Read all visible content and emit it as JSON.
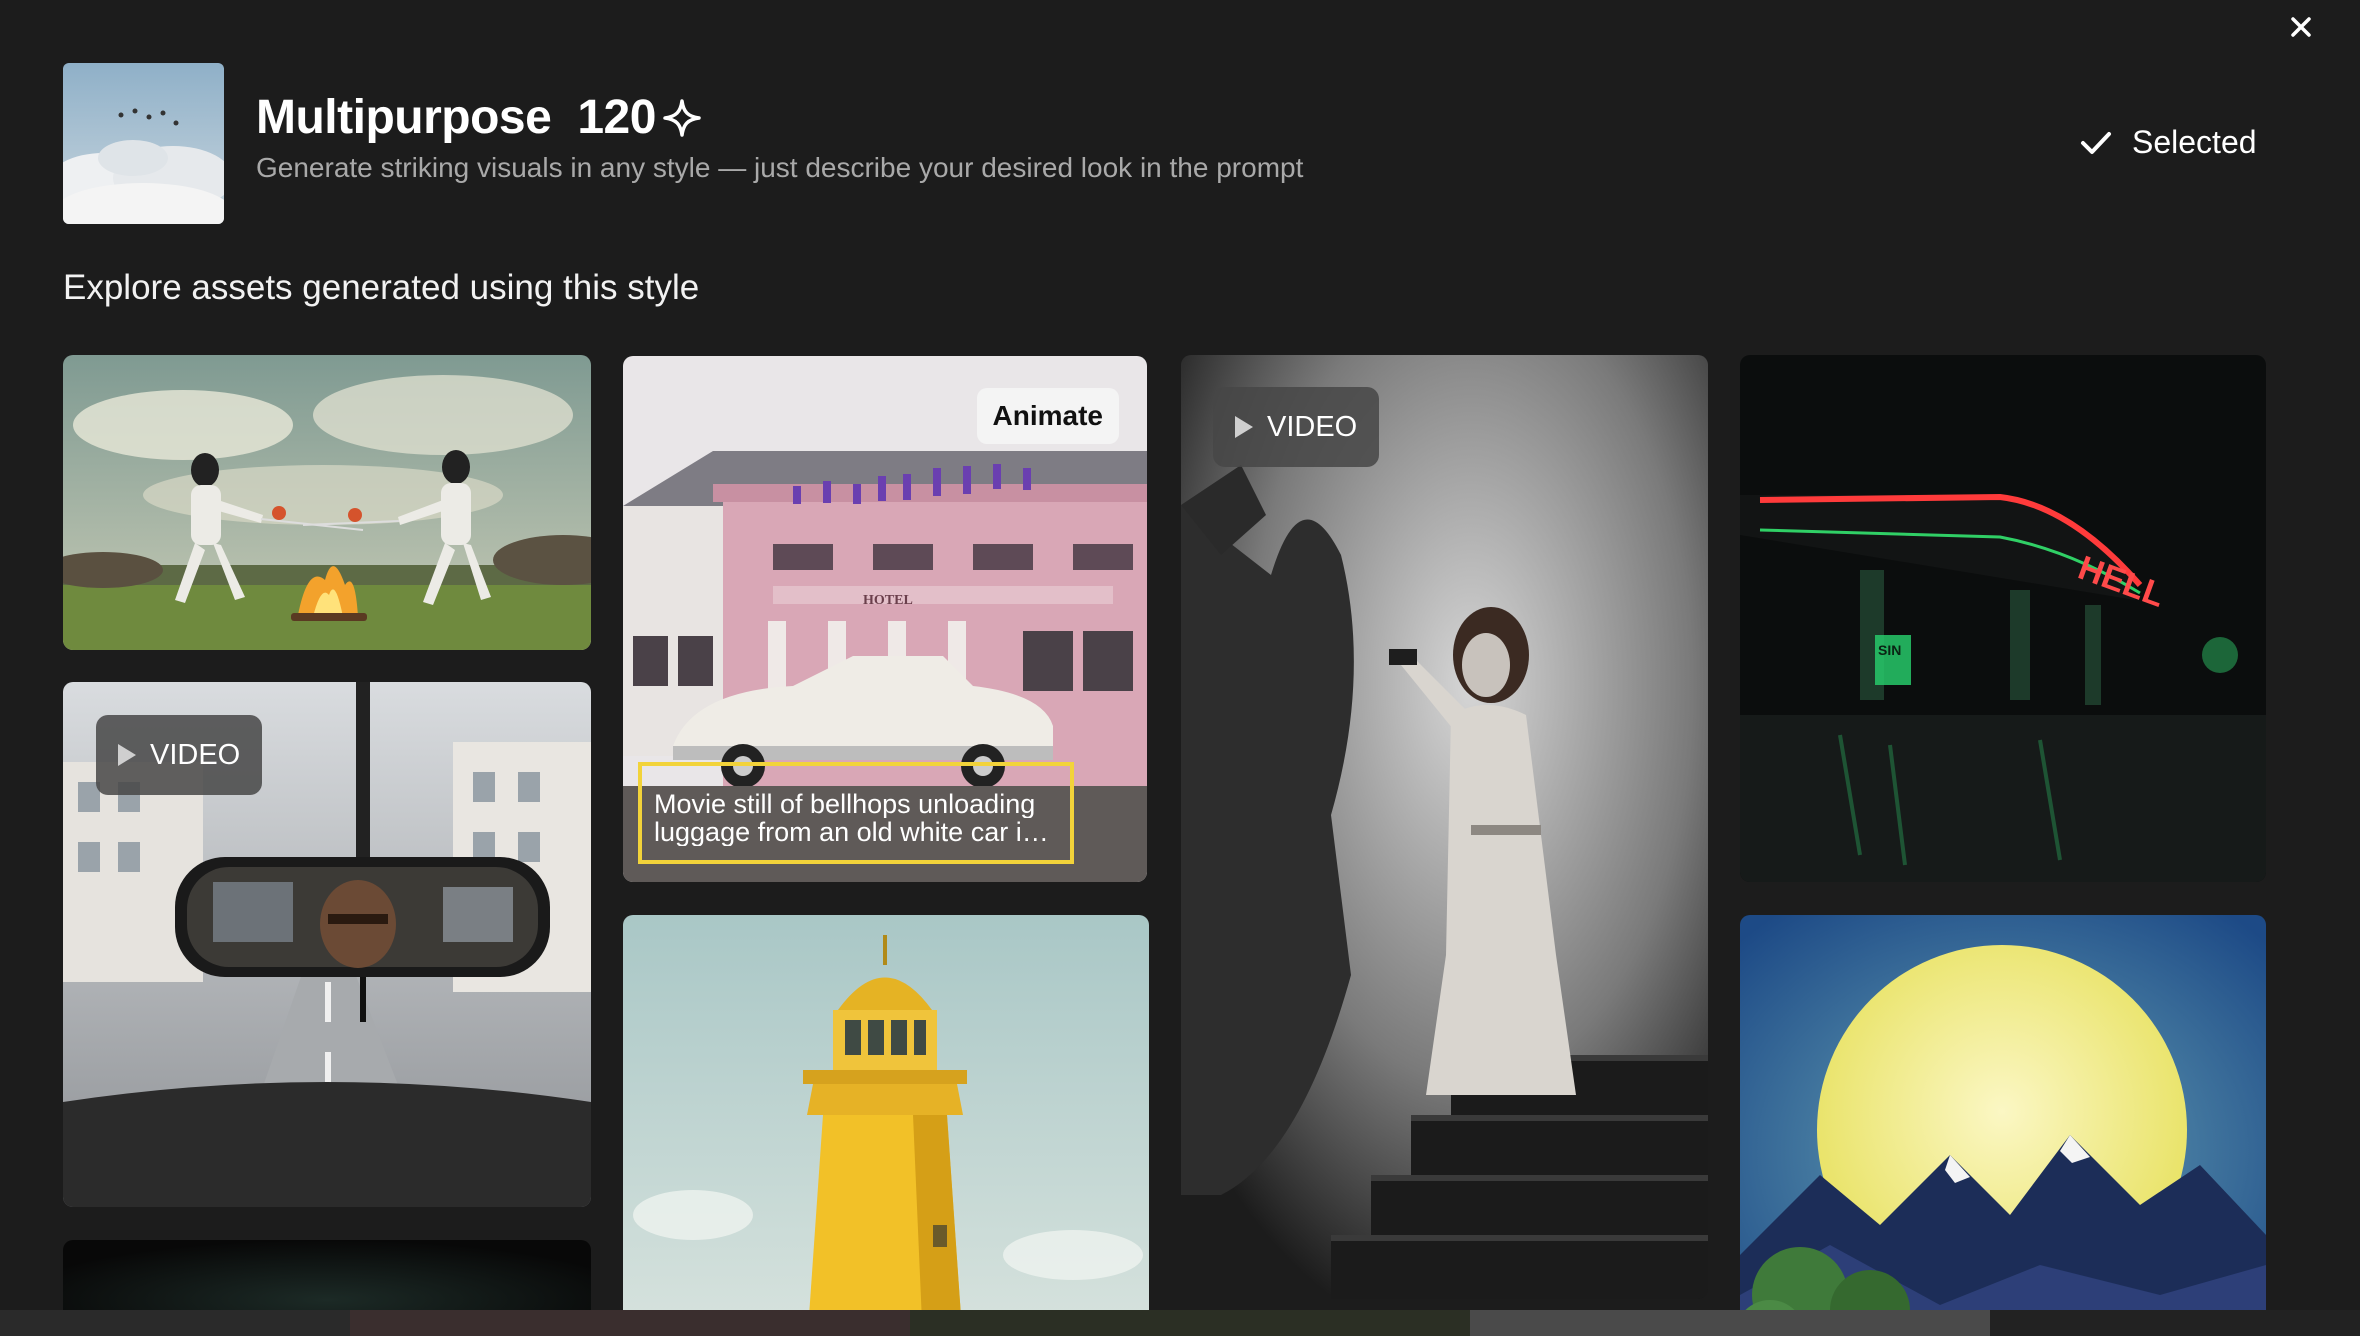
{
  "style": {
    "name": "Multipurpose",
    "count": "120",
    "description": "Generate striking visuals in any style — just describe your desired look in the prompt",
    "status": "Selected"
  },
  "section_title": "Explore assets generated using this style",
  "badges": {
    "video": "VIDEO",
    "animate": "Animate"
  },
  "cards": [
    {
      "subject": "Fencers around a campfire",
      "type": "image"
    },
    {
      "subject": "Rear-view mirror driver",
      "type": "video"
    },
    {
      "subject": "Pink hotel with bellhops",
      "type": "image",
      "caption_line1": "Movie still of bellhops unloading",
      "caption_line2": "luggage from an old white car in..."
    },
    {
      "subject": "Yellow lighthouse",
      "type": "image"
    },
    {
      "subject": "Noir woman with gun on stairs",
      "type": "video"
    },
    {
      "subject": "Neon gas station HELL",
      "type": "image",
      "sign": "HELL",
      "sign2": "SIN"
    },
    {
      "subject": "Moon over mountains",
      "type": "image"
    }
  ],
  "colors": {
    "modal_bg": "#1c1c1c",
    "highlight": "#f2d33a",
    "muted_text": "#a9a9a9"
  },
  "icons": [
    "close-icon",
    "sparkle-icon",
    "check-icon",
    "play-icon"
  ]
}
